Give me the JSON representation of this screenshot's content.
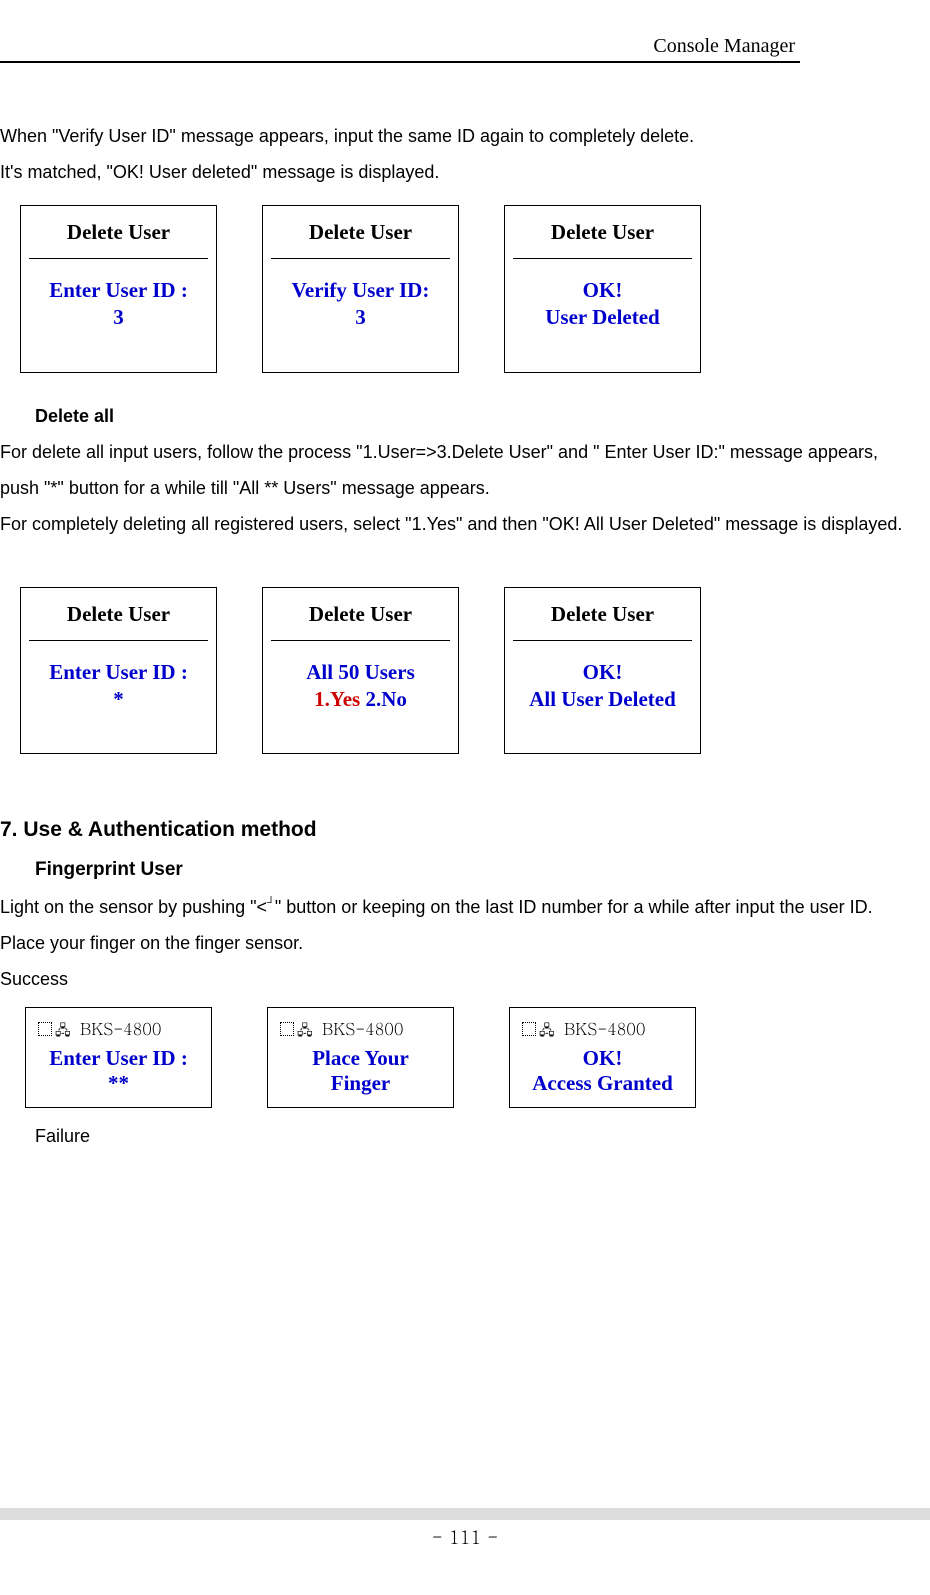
{
  "header": "Console Manager",
  "para1": "When \"Verify User ID\" message appears, input the same ID again to completely delete.",
  "para2": "It's matched, \"OK! User deleted\" message is displayed.",
  "screens_row1": {
    "s1": {
      "title": "Delete User",
      "line1": "Enter User ID :",
      "line2": "3"
    },
    "s2": {
      "title": "Delete User",
      "line1": "Verify User ID:",
      "line2": "3"
    },
    "s3": {
      "title": "Delete User",
      "line1": "OK!",
      "line2": "User Deleted"
    }
  },
  "deleteall_heading": "Delete all",
  "para3": "For delete all input users, follow the process \"1.User=>3.Delete User\" and \" Enter User ID:\" message appears, push \"*\" button for a while till \"All ** Users\" message appears.",
  "para4": "For completely deleting all registered users, select \"1.Yes\" and then \"OK! All User Deleted\" message is displayed.",
  "screens_row2": {
    "s1": {
      "title": "Delete User",
      "line1": "Enter User ID :",
      "line2": "*"
    },
    "s2": {
      "title": "Delete User",
      "line1": "All 50 Users",
      "yes": "1.Yes ",
      "no": "2.No"
    },
    "s3": {
      "title": "Delete User",
      "line1": "OK!",
      "line2": "All User Deleted"
    }
  },
  "section7": "7.   Use & Authentication method",
  "fingerprint_heading": "Fingerprint User",
  "para5a": "Light on the sensor by pushing \"<",
  "para5b": "\" button or keeping on the last ID number for a while after input the user ID.",
  "para6": "Place your finger on the finger sensor.",
  "para7": "Success",
  "device": "BKS-4800",
  "small_row": {
    "s1": {
      "line1": "Enter User ID :",
      "line2": "**"
    },
    "s2": {
      "line1": "Place Your",
      "line2": "Finger"
    },
    "s3": {
      "line1": "OK!",
      "line2": "Access Granted"
    }
  },
  "failure": "Failure",
  "pagenum": "- 111 -"
}
